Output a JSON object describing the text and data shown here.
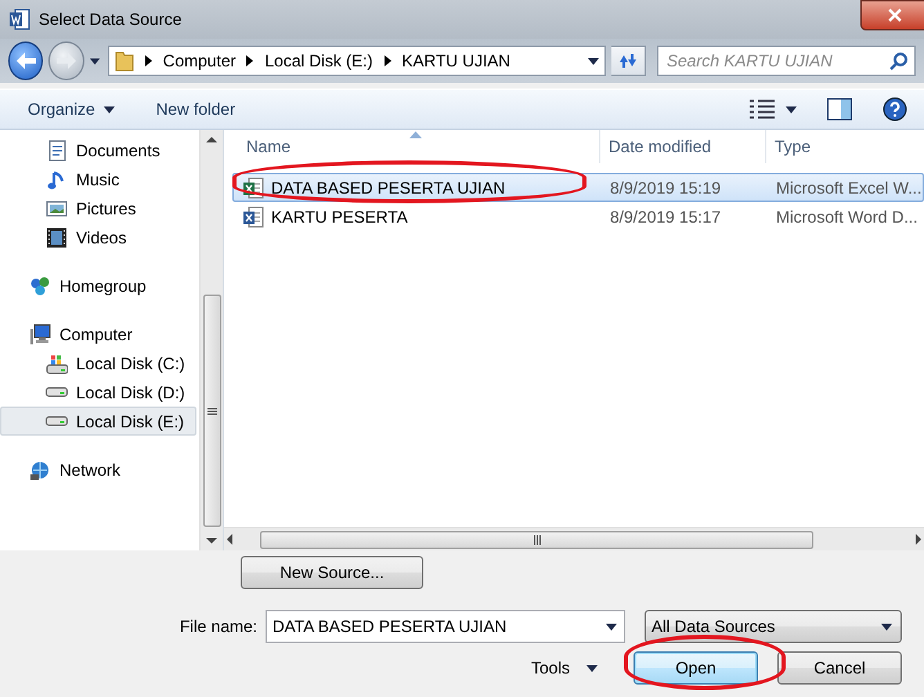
{
  "window": {
    "title": "Select Data Source"
  },
  "address": {
    "crumbs": [
      "Computer",
      "Local Disk (E:)",
      "KARTU UJIAN"
    ]
  },
  "search": {
    "placeholder": "Search KARTU UJIAN"
  },
  "toolbar": [
    {
      "label": "Organize",
      "has_menu": true
    },
    {
      "label": "New folder",
      "has_menu": false
    }
  ],
  "sidebar": {
    "groups": [
      {
        "items": [
          {
            "label": "Documents",
            "kind": "documents",
            "selected": false
          },
          {
            "label": "Music",
            "kind": "music",
            "selected": false
          },
          {
            "label": "Pictures",
            "kind": "pictures",
            "selected": false
          },
          {
            "label": "Videos",
            "kind": "videos",
            "selected": false
          }
        ]
      },
      {
        "label": "Homegroup",
        "kind": "homegroup"
      },
      {
        "label": "Computer",
        "kind": "computer",
        "children": [
          {
            "label": "Local Disk (C:)",
            "kind": "system-drive",
            "selected": false
          },
          {
            "label": "Local Disk (D:)",
            "kind": "drive",
            "selected": false
          },
          {
            "label": "Local Disk (E:)",
            "kind": "drive",
            "selected": true
          }
        ]
      },
      {
        "label": "Network",
        "kind": "network"
      }
    ]
  },
  "table": {
    "columns": [
      {
        "label": "Name",
        "sorted": true
      },
      {
        "label": "Date modified",
        "sorted": false
      },
      {
        "label": "Type",
        "sorted": false
      }
    ],
    "rows": [
      {
        "name": "DATA BASED PESERTA UJIAN",
        "date": "8/9/2019 15:19",
        "type": "Microsoft Excel W...",
        "kind": "excel",
        "selected": true,
        "circled": true
      },
      {
        "name": "KARTU PESERTA",
        "date": "8/9/2019 15:17",
        "type": "Microsoft Word D...",
        "kind": "word",
        "selected": false,
        "circled": false
      }
    ]
  },
  "new_source_button": "New Source...",
  "file_name": {
    "label": "File name:",
    "value": "DATA BASED PESERTA UJIAN"
  },
  "filter": {
    "value": "All Data Sources"
  },
  "tools": "Tools",
  "buttons": [
    {
      "label": "Open",
      "kind": "default",
      "circled": true
    },
    {
      "label": "Cancel",
      "kind": "normal",
      "circled": false
    }
  ]
}
